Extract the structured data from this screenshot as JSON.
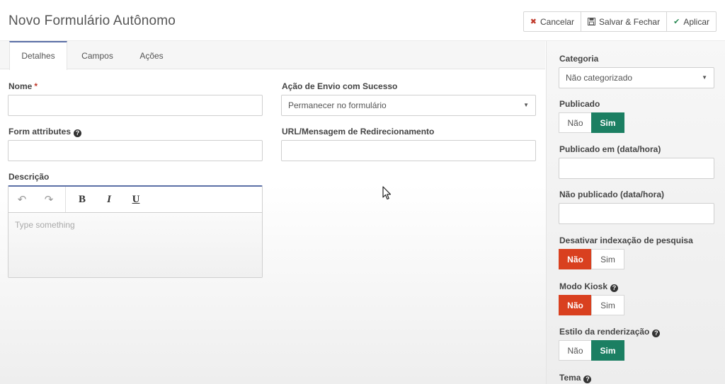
{
  "header": {
    "title": "Novo Formulário Autônomo",
    "buttons": {
      "cancel": "Cancelar",
      "save_close": "Salvar & Fechar",
      "apply": "Aplicar"
    }
  },
  "tabs": [
    {
      "label": "Detalhes",
      "active": true
    },
    {
      "label": "Campos",
      "active": false
    },
    {
      "label": "Ações",
      "active": false
    }
  ],
  "form": {
    "name_label": "Nome",
    "name_required_mark": "*",
    "name_value": "",
    "form_attributes_label": "Form attributes",
    "form_attributes_value": "",
    "description_label": "Descrição",
    "editor_placeholder": "Type something",
    "editor_tools": {
      "undo": "↶",
      "redo": "↷",
      "bold": "B",
      "italic": "I",
      "underline": "U"
    },
    "submit_action_label": "Ação de Envio com Sucesso",
    "submit_action_value": "Permanecer no formulário",
    "redirect_label": "URL/Mensagem de Redirecionamento",
    "redirect_value": ""
  },
  "sidebar": {
    "category_label": "Categoria",
    "category_value": "Não categorizado",
    "published_label": "Publicado",
    "published": {
      "no": "Não",
      "yes": "Sim",
      "selected": "yes"
    },
    "publish_up_label": "Publicado em (data/hora)",
    "publish_down_label": "Não publicado (data/hora)",
    "no_index_label": "Desativar indexação de pesquisa",
    "no_index": {
      "no": "Não",
      "yes": "Sim",
      "selected": "no"
    },
    "kiosk_label": "Modo Kiosk",
    "kiosk": {
      "no": "Não",
      "yes": "Sim",
      "selected": "no"
    },
    "render_style_label": "Estilo da renderização",
    "render_style": {
      "no": "Não",
      "yes": "Sim",
      "selected": "yes"
    },
    "theme_label": "Tema"
  },
  "colors": {
    "accent_green": "#1b7f62",
    "accent_red": "#d9401f",
    "tab_active_border": "#5b6fa6"
  }
}
